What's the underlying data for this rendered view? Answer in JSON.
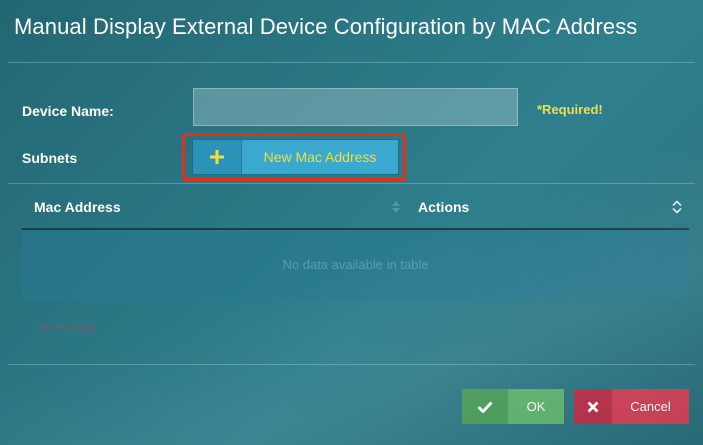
{
  "dialog": {
    "title": "Manual Display External Device Configuration by MAC Address"
  },
  "form": {
    "device_name_label": "Device Name:",
    "device_name_value": "",
    "required_note": "*Required!",
    "subnets_label": "Subnets",
    "new_mac_button_label": "New Mac Address",
    "new_mac_button_icon": "plus-icon"
  },
  "grid": {
    "columns": [
      "Mac Address",
      "Actions"
    ],
    "empty_message": "No data available in table",
    "sort_icon": "sort-icon"
  },
  "validation": {
    "error_text": "No records"
  },
  "footer": {
    "ok_label": "OK",
    "ok_icon": "check-icon",
    "cancel_label": "Cancel",
    "cancel_icon": "close-icon"
  },
  "colors": {
    "background": "#2a7683",
    "required": "#e6e24a",
    "highlight": "#e0301e",
    "button_primary": "#3aa8cf",
    "button_label": "#f2e03a",
    "ok": "#5fb36d",
    "cancel": "#d04158"
  }
}
